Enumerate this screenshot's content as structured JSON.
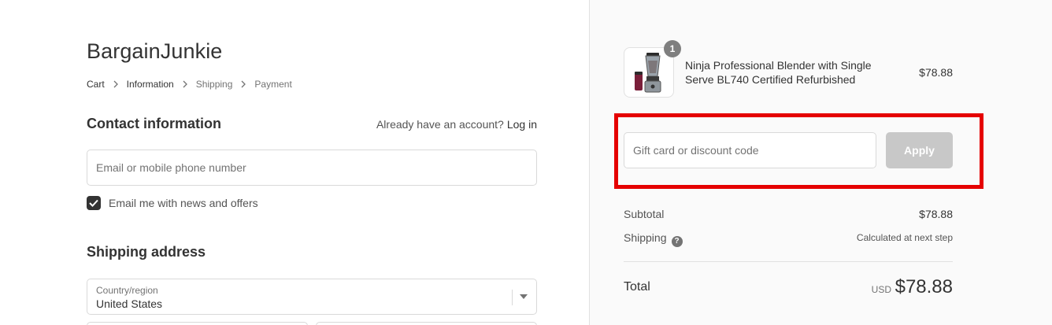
{
  "shop": {
    "name": "BargainJunkie"
  },
  "breadcrumb": [
    "Cart",
    "Information",
    "Shipping",
    "Payment"
  ],
  "contact": {
    "title": "Contact information",
    "account_prompt": "Already have an account?",
    "login_label": "Log in",
    "email_placeholder": "Email or mobile phone number",
    "newsletter_label": "Email me with news and offers",
    "newsletter_checked": true
  },
  "shipping": {
    "title": "Shipping address",
    "country_label": "Country/region",
    "country_value": "United States"
  },
  "order": {
    "item": {
      "quantity": "1",
      "name": "Ninja Professional Blender with Single Serve BL740 Certified Refurbished",
      "price": "$78.88"
    },
    "discount": {
      "placeholder": "Gift card or discount code",
      "apply_label": "Apply"
    },
    "subtotal_label": "Subtotal",
    "subtotal_value": "$78.88",
    "shipping_label": "Shipping",
    "shipping_value": "Calculated at next step",
    "total_label": "Total",
    "total_currency": "USD",
    "total_value": "$78.88"
  },
  "colors": {
    "highlight": "#e50000",
    "checkbox": "#333333",
    "apply_disabled": "#c8c8c8",
    "sidebar_bg": "#fafafa"
  }
}
